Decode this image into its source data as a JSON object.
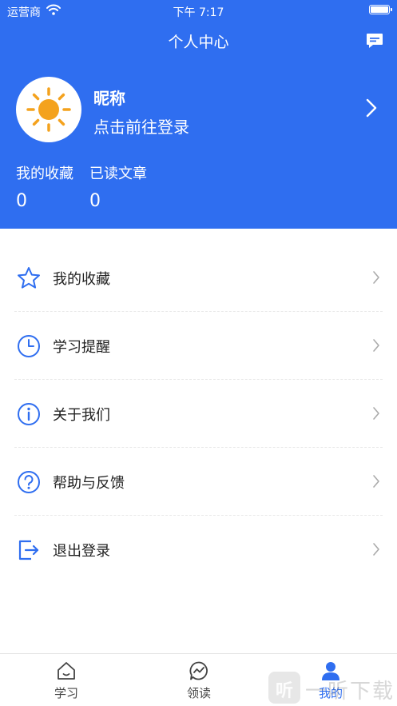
{
  "status_bar": {
    "carrier": "运营商",
    "time": "下午 7:17"
  },
  "nav": {
    "title": "个人中心"
  },
  "profile": {
    "nickname": "昵称",
    "login_prompt": "点击前往登录"
  },
  "stats": [
    {
      "label": "我的收藏",
      "value": "0"
    },
    {
      "label": "已读文章",
      "value": "0"
    }
  ],
  "menu": [
    {
      "label": "我的收藏",
      "icon": "star-icon"
    },
    {
      "label": "学习提醒",
      "icon": "clock-icon"
    },
    {
      "label": "关于我们",
      "icon": "info-icon"
    },
    {
      "label": "帮助与反馈",
      "icon": "help-icon"
    },
    {
      "label": "退出登录",
      "icon": "logout-icon"
    }
  ],
  "tabbar": {
    "items": [
      {
        "label": "学习",
        "icon": "home-icon"
      },
      {
        "label": "领读",
        "icon": "chat-wave-icon"
      },
      {
        "label": "我的",
        "icon": "person-icon",
        "active": true
      }
    ]
  },
  "watermark": {
    "text": "一听下载",
    "glyph": "听"
  },
  "colors": {
    "primary": "#2f6ef0",
    "sun": "#f4a21d",
    "icon": "#2f6ef0"
  }
}
